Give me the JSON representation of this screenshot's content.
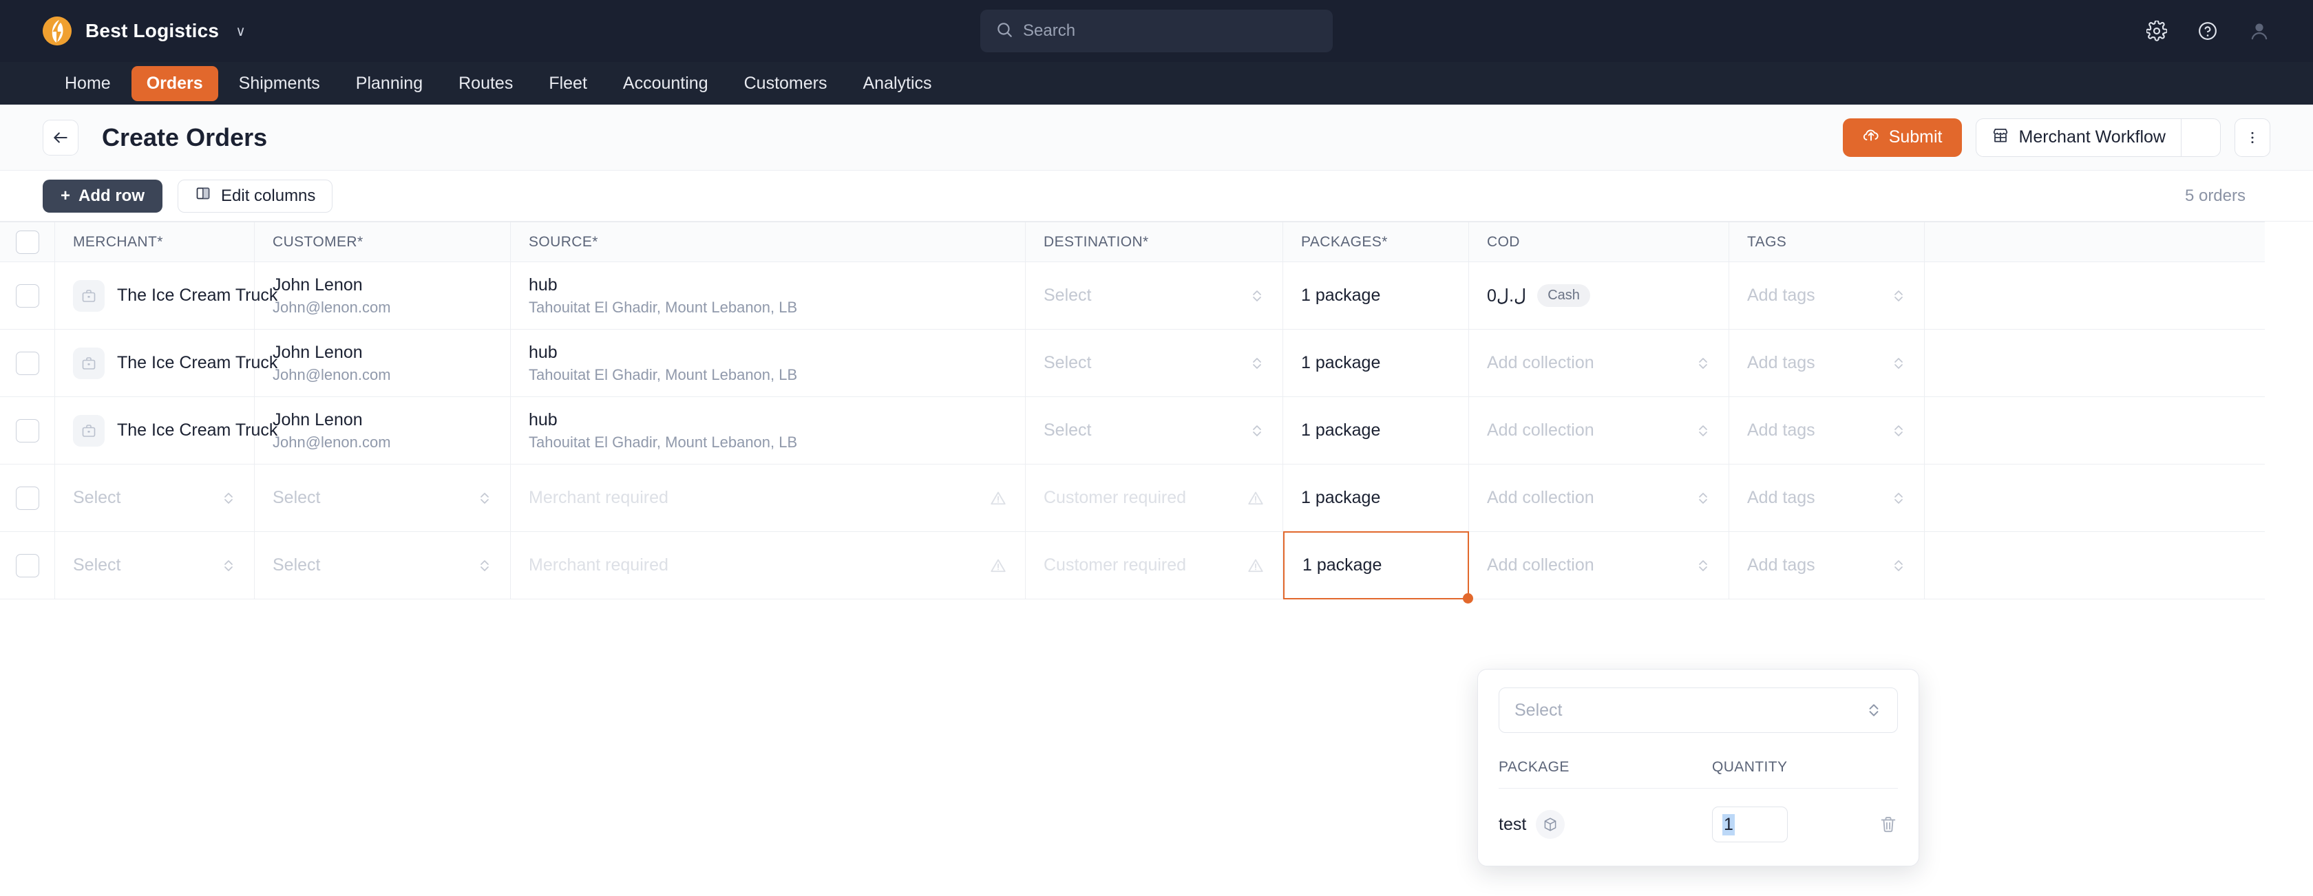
{
  "topbar": {
    "brand_name": "Best Logistics",
    "brand_caret": "∨",
    "search_placeholder": "Search",
    "search_value": "",
    "icons": [
      "gear-icon",
      "help-icon",
      "user-icon"
    ],
    "background": "#1a2030",
    "logo_color": "#f0a030"
  },
  "nav": {
    "items": [
      {
        "label": "Home",
        "active": false
      },
      {
        "label": "Orders",
        "active": true
      },
      {
        "label": "Shipments",
        "active": false
      },
      {
        "label": "Planning",
        "active": false
      },
      {
        "label": "Routes",
        "active": false
      },
      {
        "label": "Fleet",
        "active": false
      },
      {
        "label": "Accounting",
        "active": false
      },
      {
        "label": "Customers",
        "active": false
      },
      {
        "label": "Analytics",
        "active": false
      }
    ],
    "active_color": "#e2682c"
  },
  "page_header": {
    "title": "Create Orders",
    "submit_label": "Submit",
    "workflow_label": "Merchant Workflow",
    "workflow_caret": "∨",
    "kebab": "⋮"
  },
  "toolbar": {
    "add_row_label": "Add row",
    "add_row_plus": "+",
    "edit_columns_label": "Edit columns",
    "orders_count": "5 orders"
  },
  "grid": {
    "columns": [
      {
        "key": "merchant",
        "label": "MERCHANT",
        "required": "*"
      },
      {
        "key": "customer",
        "label": "CUSTOMER",
        "required": "*"
      },
      {
        "key": "source",
        "label": "SOURCE",
        "required": "*"
      },
      {
        "key": "destination",
        "label": "DESTINATION",
        "required": "*"
      },
      {
        "key": "packages",
        "label": "PACKAGES",
        "required": "*"
      },
      {
        "key": "cod",
        "label": "COD",
        "required": ""
      },
      {
        "key": "tags",
        "label": "TAGS",
        "required": ""
      }
    ],
    "placeholders": {
      "select": "Select",
      "add_collection": "Add collection",
      "add_tags": "Add tags",
      "merchant_required": "Merchant required",
      "customer_required": "Customer required"
    },
    "rows": [
      {
        "merchant": "The Ice Cream Truck",
        "customer_name": "John Lenon",
        "customer_email": "John@lenon.com",
        "source_name": "hub",
        "source_address": "Tahouitat El Ghadir, Mount Lebanon, LB",
        "destination": "Select",
        "packages": "1 package",
        "cod_amount": "0ل.ل",
        "cod_type": "Cash",
        "tags": "Add tags"
      },
      {
        "merchant": "The Ice Cream Truck",
        "customer_name": "John Lenon",
        "customer_email": "John@lenon.com",
        "source_name": "hub",
        "source_address": "Tahouitat El Ghadir, Mount Lebanon, LB",
        "destination": "Select",
        "packages": "1 package",
        "cod_amount": "Add collection",
        "cod_type": "",
        "tags": "Add tags"
      },
      {
        "merchant": "The Ice Cream Truck",
        "customer_name": "John Lenon",
        "customer_email": "John@lenon.com",
        "source_name": "hub",
        "source_address": "Tahouitat El Ghadir, Mount Lebanon, LB",
        "destination": "Select",
        "packages": "1 package",
        "cod_amount": "Add collection",
        "cod_type": "",
        "tags": "Add tags"
      },
      {
        "merchant": "Select",
        "customer_name": "Select",
        "source_name": "Merchant required",
        "destination": "Customer required",
        "packages": "1 package",
        "cod_amount": "Add collection",
        "cod_type": "",
        "tags": "Add tags"
      },
      {
        "merchant": "Select",
        "customer_name": "Select",
        "source_name": "Merchant required",
        "destination": "Customer required",
        "packages": "1 package",
        "cod_amount": "Add collection",
        "cod_type": "",
        "tags": "Add tags"
      }
    ],
    "active_cell": {
      "row": 5,
      "column": "packages",
      "border_color": "#e2682c"
    }
  },
  "popup": {
    "select_placeholder": "Select",
    "col_package": "PACKAGE",
    "col_quantity": "QUANTITY",
    "package_name": "test",
    "quantity": "1"
  }
}
